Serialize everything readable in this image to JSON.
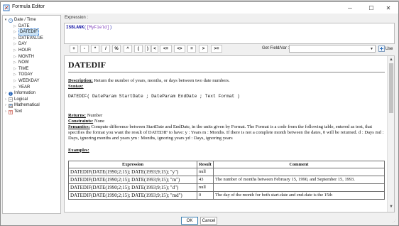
{
  "window": {
    "title": "Formula Editor",
    "minimize_glyph": "─",
    "maximize_glyph": "☐",
    "close_glyph": "✕"
  },
  "tree": {
    "date_time_group": "Date / Time",
    "date_items": [
      "DATE",
      "DATEDIF",
      "DATEVALUE",
      "DAY",
      "HOUR",
      "MONTH",
      "NOW",
      "TIME",
      "TODAY",
      "WEEKDAY",
      "YEAR"
    ],
    "other_groups": [
      "Information",
      "Logical",
      "Mathematical",
      "Text"
    ],
    "selected": "DATEDIF"
  },
  "expression": {
    "label": "Expression :",
    "function": "ISBLANK",
    "open_paren": "(",
    "argument": "[MyField]",
    "close_paren": ")"
  },
  "operators": [
    "+",
    "-",
    "*",
    "/",
    "%",
    "^",
    "(",
    ")",
    "<",
    "<=",
    "<>",
    "=",
    ">",
    ">="
  ],
  "get_field": {
    "label": "Get Field/Var :",
    "value": "",
    "use_label": "Use"
  },
  "doc": {
    "title": "DATEDIF",
    "description_label": "Description:",
    "description_text": " Return the number of years, months, or days between two date numbers.",
    "syntax_label": "Syntax:",
    "syntax_text": "DATEDIF( DateParam StartDate ; DateParam EndDate ; Text Format )",
    "returns_label": "Returns:",
    "returns_text": " Number",
    "constraints_label": "Constraints:",
    "constraints_text": " None",
    "semantics_label": "Semantics:",
    "semantics_text": " Compute difference between StartDate and EndDate, in the units given by Format. The Format is a code from the following table, entered as text, that specifies the format you want the result of DATEDIF to have: y : Years m : Months. If there is not a complete month between the dates, 0 will be returned. d : Days md : Days, ignoring months and years ym : Months, ignoring years yd : Days, ignoring years",
    "examples_label": "Examples:",
    "table_headers": [
      "Expression",
      "Result",
      "Comment"
    ],
    "rows": [
      {
        "expr": "DATEDIF(DATE(1990;2;15); DATE(1993;9;15); \"y\")",
        "result": "null",
        "comment": ""
      },
      {
        "expr": "DATEDIF(DATE(1990;2;15); DATE(1993;9;15); \"m\")",
        "result": "43",
        "comment": "The number of months between February 15, 1990, and September 15, 1993."
      },
      {
        "expr": "DATEDIF(DATE(1990;2;15); DATE(1993;9;15); \"d\")",
        "result": "null",
        "comment": ""
      },
      {
        "expr": "DATEDIF(DATE(1990;2;15); DATE(1993;9;15); \"md\")",
        "result": "0",
        "comment": "The day of the month for both start-date and end-date is the 15th"
      }
    ]
  },
  "buttons": {
    "ok": "OK",
    "cancel": "Cancel"
  }
}
